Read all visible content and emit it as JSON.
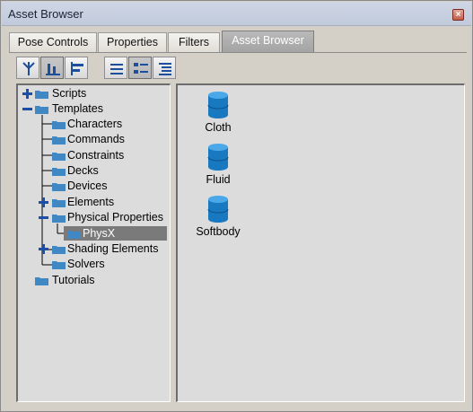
{
  "window": {
    "title": "Asset Browser",
    "close_glyph": "×"
  },
  "tabs": [
    {
      "label": "Pose Controls",
      "active": false
    },
    {
      "label": "Properties",
      "active": false
    },
    {
      "label": "Filters",
      "active": false
    },
    {
      "label": "Asset Browser",
      "active": true
    }
  ],
  "toolbar": [
    {
      "icon": "tree-hierarchy-icon",
      "pressed": false
    },
    {
      "icon": "align-bottom-icon",
      "pressed": true
    },
    {
      "icon": "align-left-icon",
      "pressed": false
    },
    {
      "icon": "list-view-icon",
      "pressed": false
    },
    {
      "icon": "icon-view-icon",
      "pressed": true
    },
    {
      "icon": "detail-list-icon",
      "pressed": false
    }
  ],
  "tree": [
    {
      "label": "Scripts",
      "level": 0,
      "expander": "+"
    },
    {
      "label": "Templates",
      "level": 0,
      "expander": "-"
    },
    {
      "label": "Characters",
      "level": 1
    },
    {
      "label": "Commands",
      "level": 1
    },
    {
      "label": "Constraints",
      "level": 1
    },
    {
      "label": "Decks",
      "level": 1
    },
    {
      "label": "Devices",
      "level": 1
    },
    {
      "label": "Elements",
      "level": 1,
      "expander": "+"
    },
    {
      "label": "Physical Properties",
      "level": 1,
      "expander": "-"
    },
    {
      "label": "PhysX",
      "level": 2,
      "selected": true
    },
    {
      "label": "Shading Elements",
      "level": 1,
      "expander": "+"
    },
    {
      "label": "Solvers",
      "level": 1
    },
    {
      "label": "Tutorials",
      "level": 0
    }
  ],
  "assets": [
    {
      "label": "Cloth",
      "icon": "database-icon"
    },
    {
      "label": "Fluid",
      "icon": "database-icon"
    },
    {
      "label": "Softbody",
      "icon": "database-icon"
    }
  ],
  "colors": {
    "title_bar": "#c8d0e0",
    "active_tab": "#a9a9a9",
    "selection": "#7a7a7a",
    "folder": "#3f88c4",
    "expander": "#1c4fa8",
    "asset_icon": "#1878c0"
  }
}
